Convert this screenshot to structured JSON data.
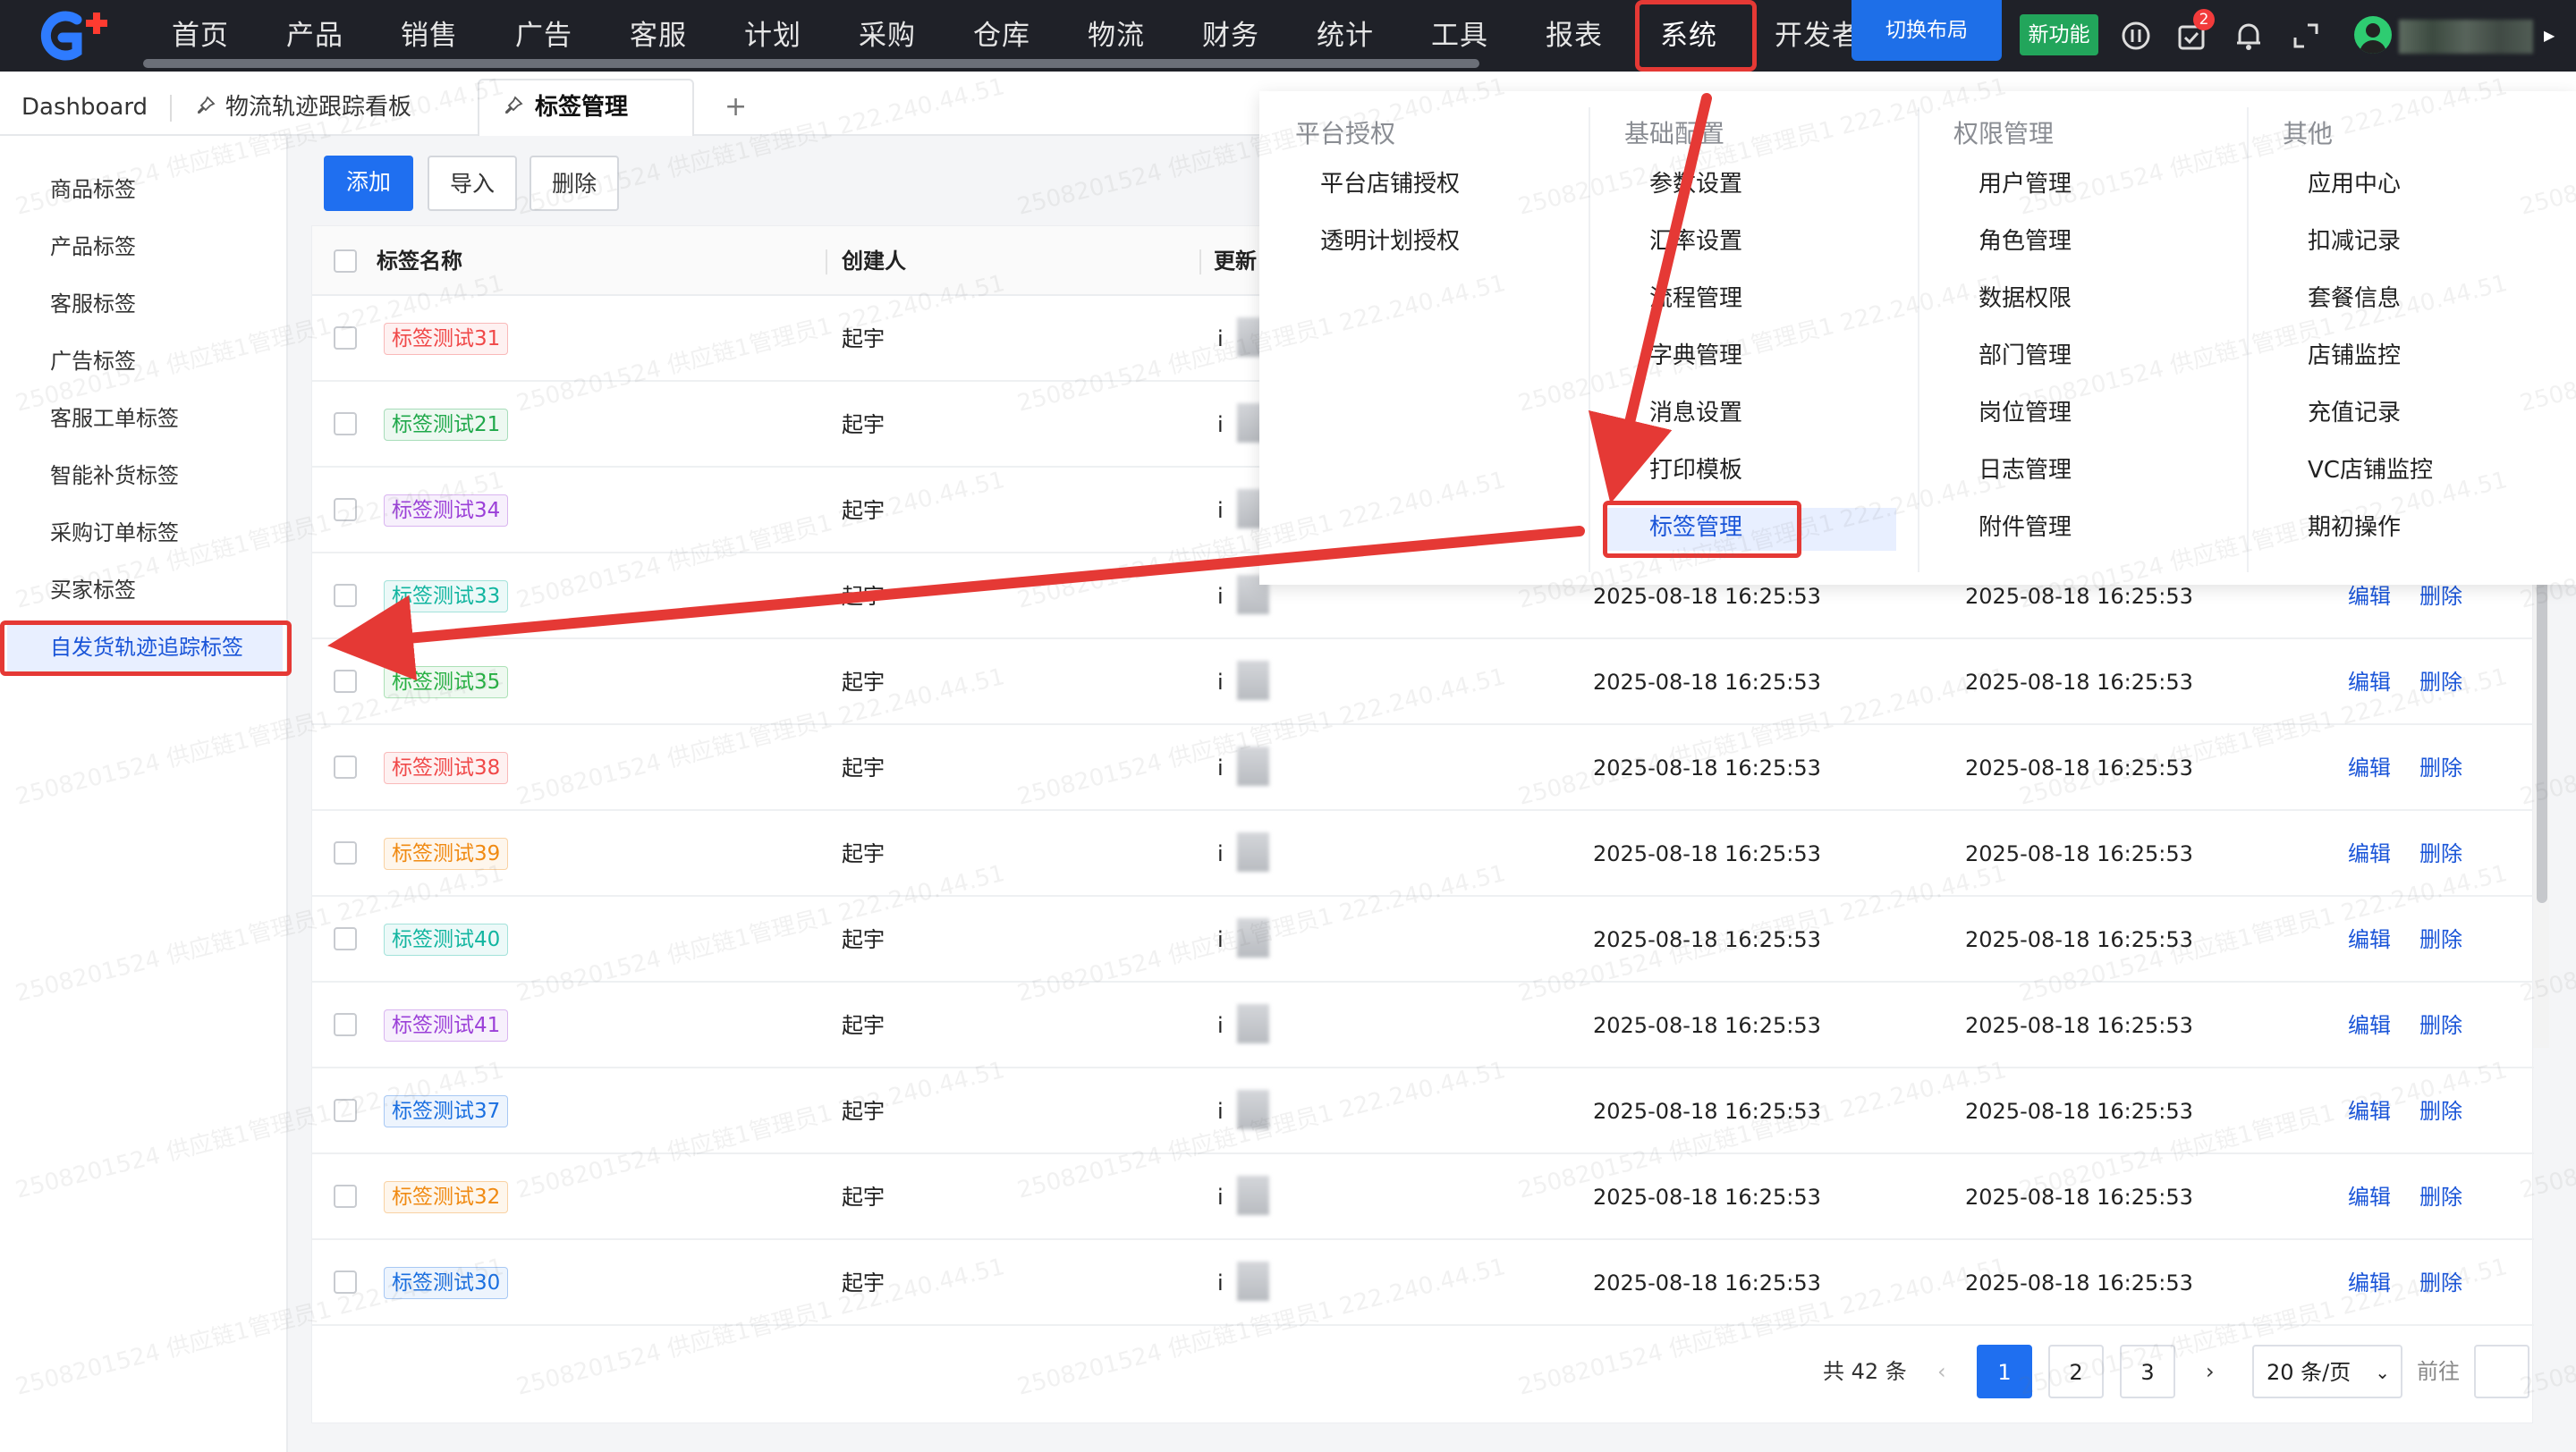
{
  "topbar": {
    "nav": [
      "首页",
      "产品",
      "销售",
      "广告",
      "客服",
      "计划",
      "采购",
      "仓库",
      "物流",
      "财务",
      "统计",
      "工具",
      "报表",
      "系统",
      "开发者"
    ],
    "active_nav": "系统",
    "switch_layout": "切换布局",
    "new_feature": "新功能",
    "notification_count": "2",
    "icons": [
      "logo-icon",
      "info-icon",
      "tasks-icon",
      "bell-icon",
      "fullscreen-icon",
      "avatar-icon",
      "caret-right-icon"
    ]
  },
  "tabs": {
    "items": [
      "Dashboard",
      "物流轨迹跟踪看板",
      "标签管理"
    ],
    "active": "标签管理",
    "add_tab": "+"
  },
  "sidebar": {
    "items": [
      "商品标签",
      "产品标签",
      "客服标签",
      "广告标签",
      "客服工单标签",
      "智能补货标签",
      "采购订单标签",
      "买家标签",
      "自发货轨迹追踪标签"
    ],
    "active": "自发货轨迹追踪标签"
  },
  "toolbar": {
    "add": "添加",
    "import": "导入",
    "delete": "删除"
  },
  "table": {
    "columns": [
      "标签名称",
      "创建人",
      "更新"
    ],
    "rows": [
      {
        "tag": "标签测试31",
        "color": "#f04848",
        "creator": "起宇",
        "created": "",
        "updated": "",
        "edit": "",
        "delete": ""
      },
      {
        "tag": "标签测试21",
        "color": "#1fa84a",
        "creator": "起宇",
        "created": "",
        "updated": "",
        "edit": "",
        "delete": ""
      },
      {
        "tag": "标签测试34",
        "color": "#9b40d8",
        "creator": "起宇",
        "created": "",
        "updated": "",
        "edit": "",
        "delete": ""
      },
      {
        "tag": "标签测试33",
        "color": "#12b5a0",
        "creator": "起宇",
        "created": "2025-08-18 16:25:53",
        "updated": "2025-08-18 16:25:53",
        "edit": "编辑",
        "delete": "删除"
      },
      {
        "tag": "标签测试35",
        "color": "#27b043",
        "creator": "起宇",
        "created": "2025-08-18 16:25:53",
        "updated": "2025-08-18 16:25:53",
        "edit": "编辑",
        "delete": "删除"
      },
      {
        "tag": "标签测试38",
        "color": "#f04848",
        "creator": "起宇",
        "created": "2025-08-18 16:25:53",
        "updated": "2025-08-18 16:25:53",
        "edit": "编辑",
        "delete": "删除"
      },
      {
        "tag": "标签测试39",
        "color": "#f08a12",
        "creator": "起宇",
        "created": "2025-08-18 16:25:53",
        "updated": "2025-08-18 16:25:53",
        "edit": "编辑",
        "delete": "删除"
      },
      {
        "tag": "标签测试40",
        "color": "#12b5a0",
        "creator": "起宇",
        "created": "2025-08-18 16:25:53",
        "updated": "2025-08-18 16:25:53",
        "edit": "编辑",
        "delete": "删除"
      },
      {
        "tag": "标签测试41",
        "color": "#9b40d8",
        "creator": "起宇",
        "created": "2025-08-18 16:25:53",
        "updated": "2025-08-18 16:25:53",
        "edit": "编辑",
        "delete": "删除"
      },
      {
        "tag": "标签测试37",
        "color": "#1a6fe0",
        "creator": "起宇",
        "created": "2025-08-18 16:25:53",
        "updated": "2025-08-18 16:25:53",
        "edit": "编辑",
        "delete": "删除"
      },
      {
        "tag": "标签测试32",
        "color": "#f08a12",
        "creator": "起宇",
        "created": "2025-08-18 16:25:53",
        "updated": "2025-08-18 16:25:53",
        "edit": "编辑",
        "delete": "删除"
      },
      {
        "tag": "标签测试30",
        "color": "#1a6fe0",
        "creator": "起宇",
        "created": "2025-08-18 16:25:53",
        "updated": "2025-08-18 16:25:53",
        "edit": "编辑",
        "delete": "删除"
      }
    ],
    "clipped_char": "i"
  },
  "pagination": {
    "total": "共 42 条",
    "pages": [
      "1",
      "2",
      "3"
    ],
    "current": "1",
    "prev": "‹",
    "next": "›",
    "page_size": "20 条/页",
    "goto": "前往"
  },
  "mega_menu": {
    "columns": [
      {
        "title": "平台授权",
        "items": [
          "平台店铺授权",
          "透明计划授权"
        ]
      },
      {
        "title": "基础配置",
        "items": [
          "参数设置",
          "汇率设置",
          "流程管理",
          "字典管理",
          "消息设置",
          "打印模板",
          "标签管理"
        ]
      },
      {
        "title": "权限管理",
        "items": [
          "用户管理",
          "角色管理",
          "数据权限",
          "部门管理",
          "岗位管理",
          "日志管理",
          "附件管理"
        ]
      },
      {
        "title": "其他",
        "items": [
          "应用中心",
          "扣减记录",
          "套餐信息",
          "店铺监控",
          "充值记录",
          "VC店铺监控",
          "期初操作"
        ]
      }
    ],
    "active": "标签管理"
  },
  "watermark": {
    "text": "2508201524 供应链1管理员1 222.240.44.51"
  },
  "colors": {
    "accent": "#1f6ff0",
    "topbar": "#1f2128",
    "annotation": "#e53935",
    "link": "#1a55d8"
  }
}
